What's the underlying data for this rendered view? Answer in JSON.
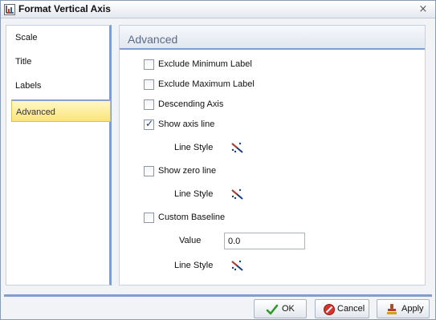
{
  "window": {
    "title": "Format Vertical Axis",
    "close_symbol": "×"
  },
  "sidebar": {
    "items": [
      {
        "label": "Scale"
      },
      {
        "label": "Title"
      },
      {
        "label": "Labels"
      },
      {
        "label": "Advanced",
        "active": true
      }
    ]
  },
  "panel": {
    "header": "Advanced",
    "options": [
      {
        "label": "Exclude Minimum Label",
        "checked": false
      },
      {
        "label": "Exclude Maximum Label",
        "checked": false
      },
      {
        "label": "Descending Axis",
        "checked": false
      },
      {
        "label": "Show axis line",
        "checked": true
      },
      {
        "label": "Show zero line",
        "checked": false
      },
      {
        "label": "Custom Baseline",
        "checked": false
      }
    ],
    "line_style_label": "Line Style",
    "line_style_icon": "line-style-picker-icon",
    "value_label": "Value",
    "value": "0.0"
  },
  "buttons": {
    "ok": "OK",
    "cancel": "Cancel",
    "apply": "Apply"
  },
  "colors": {
    "accent": "#7f9dd0",
    "selected_bg": "#fbe47a",
    "header_text": "#5a6b86"
  }
}
